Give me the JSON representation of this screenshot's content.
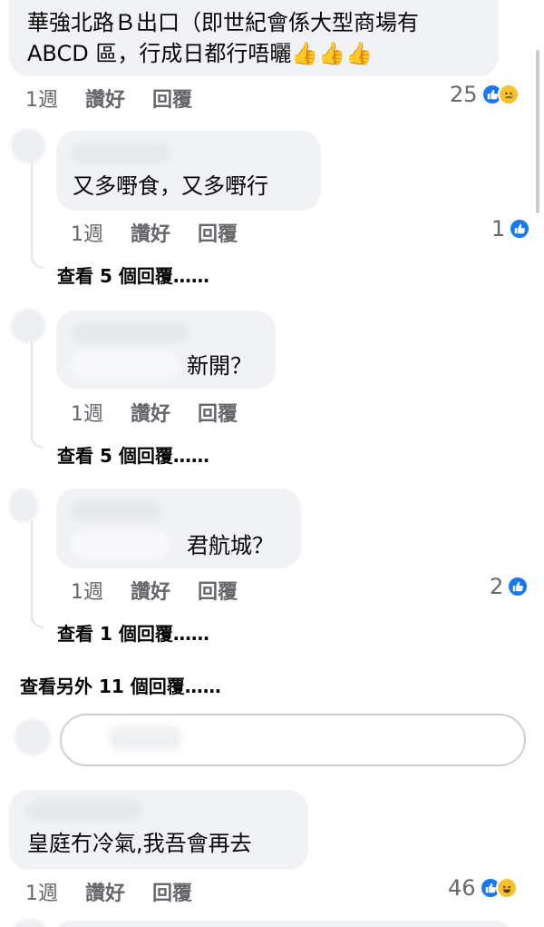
{
  "comments": [
    {
      "text_lines": [
        "華強北路Ｂ出口（即世紀會係大型商場有",
        "ABCD 區，行成日都行唔曬👍👍👍"
      ],
      "age": "1週",
      "like_label": "讚好",
      "reply_label": "回覆",
      "reactions": {
        "count": "25",
        "icons": [
          "like",
          "sad"
        ]
      }
    },
    {
      "text": "又多嘢食，又多嘢行",
      "age": "1週",
      "like_label": "讚好",
      "reply_label": "回覆",
      "reactions": {
        "count": "1",
        "icons": [
          "like"
        ]
      },
      "view_replies": "查看 5 個回覆……"
    },
    {
      "text": "新開？",
      "age": "1週",
      "like_label": "讚好",
      "reply_label": "回覆",
      "view_replies": "查看 5 個回覆……"
    },
    {
      "text": "君航城？",
      "age": "1週",
      "like_label": "讚好",
      "reply_label": "回覆",
      "reactions": {
        "count": "2",
        "icons": [
          "like"
        ]
      },
      "view_replies": "查看 1 個回覆……"
    },
    {
      "text": "皇庭冇冷氣,我吾會再去",
      "age": "1週",
      "like_label": "讚好",
      "reply_label": "回覆",
      "reactions": {
        "count": "46",
        "icons": [
          "like",
          "haha"
        ]
      }
    }
  ],
  "view_more_replies": "查看另外 11 個回覆……",
  "colors": {
    "bubble": "#f0f2f5",
    "like_blue": "#1877f2",
    "meta_gray": "#65676b",
    "emoji_yellow": "#f7c12e"
  }
}
